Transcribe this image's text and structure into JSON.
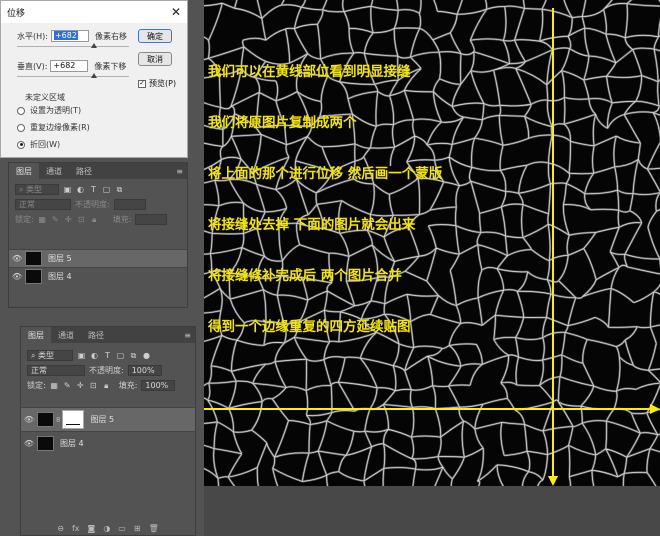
{
  "dialog": {
    "title": "位移",
    "close_glyph": "✕",
    "horizontal_label": "水平(H):",
    "horizontal_value": "+682",
    "horizontal_unit": "像素右移",
    "vertical_label": "垂直(V):",
    "vertical_value": "+682",
    "vertical_unit": "像素下移",
    "ok_label": "确定",
    "cancel_label": "取消",
    "preview_label": "预览(P)",
    "preview_checked": true,
    "undefined_area_title": "未定义区域",
    "options": [
      "设置为透明(T)",
      "重复边缘像素(R)",
      "折回(W)"
    ],
    "selected_option": 2
  },
  "panel_top": {
    "tabs": [
      "图层",
      "通道",
      "路径"
    ],
    "active_tab": 0,
    "filter_label": "类型",
    "blend_mode": "正常",
    "opacity_label": "不透明度:",
    "lock_label": "锁定:",
    "fill_label": "填充:",
    "layers": [
      {
        "name": "图层 5",
        "selected": true
      },
      {
        "name": "图层 4",
        "selected": false
      }
    ]
  },
  "panel_bottom": {
    "tabs": [
      "图层",
      "通道",
      "路径"
    ],
    "active_tab": 0,
    "filter_label": "类型",
    "blend_mode": "正常",
    "opacity_label": "不透明度:",
    "opacity_value": "100%",
    "lock_label": "锁定:",
    "fill_label": "填充:",
    "fill_value": "100%",
    "layers": [
      {
        "name": "图层 5",
        "selected": true,
        "has_mask": true
      },
      {
        "name": "图层 4",
        "selected": false,
        "has_mask": false
      }
    ],
    "bottom_icons": [
      "link-icon",
      "fx-icon",
      "mask-icon",
      "adjustment-icon",
      "folder-icon",
      "new-layer-icon",
      "trash-icon"
    ]
  },
  "annotation_lines": [
    "我们可以在黄线部位看到明显接缝",
    "我们将原图片复制成两个",
    "将上面的那个进行位移 然后画一个蒙版",
    "将接缝处去掉 下面的图片就会出来",
    "将接缝修补完成后 两个图片合并",
    "得到一个边缘重复的四方延续贴图"
  ],
  "colors": {
    "annotation": "#f5e600",
    "guide_line": "#ffee00",
    "selection": "#2f6fd6"
  }
}
